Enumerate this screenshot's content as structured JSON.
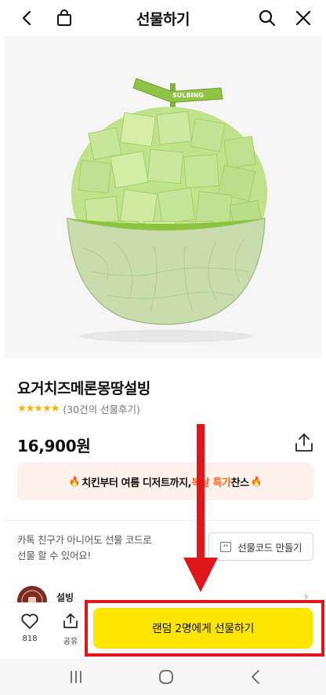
{
  "header": {
    "title": "선물하기"
  },
  "product": {
    "name": "요거치즈메론몽땅설빙",
    "stars": "★★★★★",
    "review_text": "(30건의 선물후기)",
    "price": "16,900원",
    "image_label": "SULBING"
  },
  "promo": {
    "part1": "치킨부터 여름 디저트까지, ",
    "highlight": "복날 특가",
    "part2": " 찬스"
  },
  "gift_code": {
    "line1": "카톡 친구가 아니어도 선물 코드로",
    "line2": "선물 할 수 있어요!",
    "tag": "**",
    "button_label": "선물코드 만들기"
  },
  "seller": {
    "name": "설빙"
  },
  "bottom": {
    "like_count": "818",
    "share_label": "공유",
    "cta_label": "랜덤 2명에게 선물하기"
  },
  "colors": {
    "cta": "#fee500",
    "annotation_red": "#e0161b",
    "promo_bg": "#fdf1ec",
    "promo_highlight": "#ff6a2a",
    "star": "#f2b600"
  }
}
